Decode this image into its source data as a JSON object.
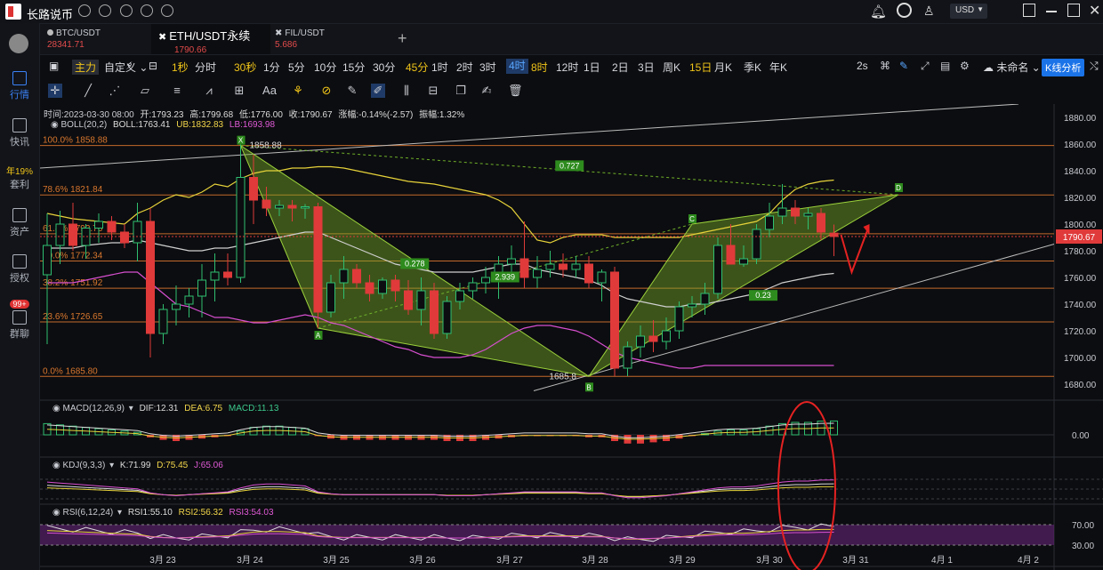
{
  "app": {
    "title": "长路说币",
    "currency": "USD"
  },
  "sidebar": [
    {
      "label": "行情",
      "active": true
    },
    {
      "label": "快讯"
    },
    {
      "label": "套利",
      "badge": "年19%"
    },
    {
      "label": "资产"
    },
    {
      "label": "授权"
    },
    {
      "label": "群聊",
      "badge": "99+"
    }
  ],
  "tabs": [
    {
      "name": "BTC/USDT",
      "price": "28341.71"
    },
    {
      "name": "ETH/USDT永续",
      "price": "1790.66",
      "active": true
    },
    {
      "name": "FIL/USDT",
      "price": "5.686"
    }
  ],
  "periods": [
    "主力",
    "自定义",
    "1秒",
    "分时",
    "30秒",
    "1分",
    "5分",
    "10分",
    "15分",
    "30分",
    "45分",
    "1时",
    "2时",
    "3时",
    "4时",
    "8时",
    "12时",
    "1日",
    "2日",
    "3日",
    "周K",
    "15日",
    "月K",
    "季K",
    "年K"
  ],
  "selected_period": "4时",
  "highlighted_periods": [
    "1秒",
    "30秒",
    "45分",
    "8时",
    "15日"
  ],
  "right_controls": {
    "interval": "2s",
    "layout": "未命名",
    "analysis_button": "K线分析"
  },
  "ohlc": {
    "time": "时间:2023-03-30 08:00",
    "open": "开:1793.23",
    "high": "高:1799.68",
    "low": "低:1776.00",
    "close": "收:1790.67",
    "change": "涨幅:-0.14%(-2.57)",
    "amplitude": "振幅:1.32%"
  },
  "boll": {
    "label": "BOLL(20,2)",
    "mid": "BOLL:1763.41",
    "ub": "UB:1832.83",
    "lb": "LB:1693.98"
  },
  "macd": {
    "label": "MACD(12,26,9)",
    "dif": "DIF:12.31",
    "dea": "DEA:6.75",
    "macd": "MACD:11.13"
  },
  "kdj": {
    "label": "KDJ(9,3,3)",
    "k": "K:71.99",
    "d": "D:75.45",
    "j": "J:65.06"
  },
  "rsi": {
    "label": "RSI(6,12,24)",
    "rsi1": "RSI1:55.10",
    "rsi2": "RSI2:56.32",
    "rsi3": "RSI3:54.03"
  },
  "fib_levels": [
    {
      "label": "100.0% 1858.88",
      "price": 1858.88
    },
    {
      "label": "78.6% 1821.84",
      "price": 1821.84
    },
    {
      "label": "61.8% 1792.76",
      "price": 1792.76
    },
    {
      "label": "50.0% 1772.34",
      "price": 1772.34
    },
    {
      "label": "38.2% 1751.92",
      "price": 1751.92
    },
    {
      "label": "23.6% 1726.65",
      "price": 1726.65
    },
    {
      "label": "0.0% 1685.80",
      "price": 1685.8
    }
  ],
  "price_axis": [
    "1880.00",
    "1860.00",
    "1840.00",
    "1820.00",
    "1800.00",
    "1780.00",
    "1760.00",
    "1740.00",
    "1720.00",
    "1700.00",
    "1680.00"
  ],
  "current_price": "1790.67",
  "indicator_axis": {
    "macd": "0.00",
    "rsi_high": "70.00",
    "rsi_low": "30.00"
  },
  "date_axis": [
    "3月 23",
    "3月 24",
    "3月 25",
    "3月 26",
    "3月 27",
    "3月 28",
    "3月 29",
    "3月 30",
    "3月 31",
    "4月 1",
    "4月 2"
  ],
  "pattern": {
    "points": [
      "X",
      "A",
      "B",
      "C",
      "D"
    ],
    "ratios": [
      "0.727",
      "0.278",
      "2.939",
      "0.23"
    ],
    "high_label": "1858.88",
    "low_label": "1685.8"
  },
  "chart_data": {
    "type": "candlestick",
    "price_range": [
      1670,
      1890
    ],
    "candles": [
      [
        1762,
        1808,
        1710,
        1784
      ],
      [
        1784,
        1810,
        1770,
        1800
      ],
      [
        1800,
        1816,
        1780,
        1784
      ],
      [
        1784,
        1800,
        1774,
        1797
      ],
      [
        1797,
        1808,
        1786,
        1802
      ],
      [
        1802,
        1806,
        1788,
        1794
      ],
      [
        1794,
        1800,
        1782,
        1786
      ],
      [
        1786,
        1816,
        1772,
        1802
      ],
      [
        1802,
        1812,
        1700,
        1718
      ],
      [
        1718,
        1740,
        1710,
        1736
      ],
      [
        1736,
        1754,
        1724,
        1740
      ],
      [
        1740,
        1752,
        1730,
        1746
      ],
      [
        1746,
        1770,
        1730,
        1758
      ],
      [
        1758,
        1778,
        1742,
        1764
      ],
      [
        1764,
        1778,
        1754,
        1760
      ],
      [
        1760,
        1860,
        1756,
        1835
      ],
      [
        1835,
        1852,
        1800,
        1818
      ],
      [
        1818,
        1828,
        1806,
        1812
      ],
      [
        1812,
        1818,
        1806,
        1814
      ],
      [
        1814,
        1818,
        1802,
        1812
      ],
      [
        1812,
        1815,
        1804,
        1813
      ],
      [
        1813,
        1816,
        1722,
        1734
      ],
      [
        1734,
        1762,
        1730,
        1756
      ],
      [
        1756,
        1776,
        1744,
        1766
      ],
      [
        1766,
        1770,
        1752,
        1756
      ],
      [
        1756,
        1762,
        1742,
        1748
      ],
      [
        1748,
        1760,
        1744,
        1758
      ],
      [
        1758,
        1762,
        1742,
        1750
      ],
      [
        1750,
        1758,
        1732,
        1736
      ],
      [
        1736,
        1760,
        1724,
        1750
      ],
      [
        1750,
        1756,
        1714,
        1718
      ],
      [
        1718,
        1746,
        1714,
        1742
      ],
      [
        1742,
        1756,
        1736,
        1750
      ],
      [
        1750,
        1760,
        1744,
        1756
      ],
      [
        1756,
        1768,
        1748,
        1760
      ],
      [
        1760,
        1776,
        1744,
        1770
      ],
      [
        1770,
        1784,
        1760,
        1774
      ],
      [
        1774,
        1802,
        1752,
        1760
      ],
      [
        1760,
        1776,
        1752,
        1766
      ],
      [
        1766,
        1780,
        1760,
        1770
      ],
      [
        1770,
        1778,
        1760,
        1766
      ],
      [
        1766,
        1776,
        1760,
        1770
      ],
      [
        1770,
        1776,
        1752,
        1756
      ],
      [
        1756,
        1766,
        1742,
        1764
      ],
      [
        1764,
        1768,
        1686,
        1692
      ],
      [
        1692,
        1712,
        1686,
        1708
      ],
      [
        1708,
        1724,
        1700,
        1716
      ],
      [
        1716,
        1728,
        1704,
        1712
      ],
      [
        1712,
        1730,
        1706,
        1720
      ],
      [
        1720,
        1742,
        1714,
        1738
      ],
      [
        1738,
        1746,
        1730,
        1740
      ],
      [
        1740,
        1756,
        1732,
        1748
      ],
      [
        1748,
        1790,
        1744,
        1784
      ],
      [
        1784,
        1800,
        1770,
        1770
      ],
      [
        1770,
        1784,
        1768,
        1774
      ],
      [
        1774,
        1800,
        1770,
        1796
      ],
      [
        1796,
        1816,
        1790,
        1806
      ],
      [
        1806,
        1830,
        1800,
        1812
      ],
      [
        1812,
        1818,
        1800,
        1806
      ],
      [
        1806,
        1812,
        1796,
        1808
      ],
      [
        1808,
        1812,
        1788,
        1794
      ],
      [
        1793.23,
        1799.68,
        1776.0,
        1790.67
      ]
    ],
    "boll_upper": [
      1808,
      1806,
      1804,
      1803,
      1802,
      1801,
      1800,
      1808,
      1812,
      1818,
      1822,
      1820,
      1824,
      1830,
      1828,
      1834,
      1838,
      1840,
      1840,
      1842,
      1842,
      1843,
      1843,
      1842,
      1840,
      1838,
      1836,
      1834,
      1832,
      1831,
      1830,
      1828,
      1826,
      1824,
      1822,
      1818,
      1812,
      1800,
      1788,
      1786,
      1790,
      1792,
      1792,
      1792,
      1790,
      1790,
      1790,
      1790,
      1790,
      1790,
      1792,
      1794,
      1796,
      1798,
      1800,
      1802,
      1808,
      1818,
      1826,
      1830,
      1832,
      1833
    ],
    "boll_mid": [
      1782,
      1782,
      1782,
      1784,
      1785,
      1786,
      1786,
      1788,
      1786,
      1784,
      1782,
      1780,
      1780,
      1782,
      1782,
      1784,
      1786,
      1788,
      1790,
      1792,
      1794,
      1794,
      1790,
      1786,
      1782,
      1778,
      1774,
      1770,
      1768,
      1766,
      1764,
      1764,
      1764,
      1764,
      1766,
      1768,
      1770,
      1770,
      1766,
      1764,
      1762,
      1760,
      1758,
      1754,
      1748,
      1744,
      1742,
      1740,
      1738,
      1738,
      1740,
      1740,
      1742,
      1744,
      1746,
      1748,
      1752,
      1756,
      1758,
      1760,
      1762,
      1763
    ],
    "boll_lower": [
      1756,
      1756,
      1756,
      1758,
      1760,
      1762,
      1764,
      1764,
      1756,
      1748,
      1740,
      1738,
      1734,
      1730,
      1730,
      1728,
      1726,
      1726,
      1728,
      1730,
      1732,
      1730,
      1726,
      1724,
      1720,
      1716,
      1712,
      1708,
      1706,
      1702,
      1700,
      1700,
      1700,
      1702,
      1706,
      1712,
      1718,
      1722,
      1724,
      1724,
      1722,
      1720,
      1716,
      1710,
      1704,
      1700,
      1698,
      1696,
      1694,
      1692,
      1692,
      1694,
      1694,
      1694,
      1694,
      1694,
      1694,
      1694,
      1694,
      1694,
      1694,
      1694
    ],
    "macd_hist": [
      9,
      8,
      7,
      6,
      5,
      4,
      3,
      2,
      -2,
      -4,
      -5,
      -4,
      -3,
      -2,
      -1,
      3,
      6,
      7,
      7,
      6,
      5,
      -1,
      -3,
      -4,
      -4,
      -4,
      -4,
      -4,
      -4,
      -4,
      -4,
      -5,
      -5,
      -5,
      -4,
      -3,
      -2,
      -1,
      -1,
      -1,
      -1,
      -1,
      -2,
      -2,
      -5,
      -7,
      -7,
      -6,
      -5,
      -3,
      -1,
      1,
      3,
      4,
      4,
      5,
      7,
      9,
      10,
      10,
      11,
      11.13
    ],
    "rsi_band": [
      30,
      70
    ]
  }
}
